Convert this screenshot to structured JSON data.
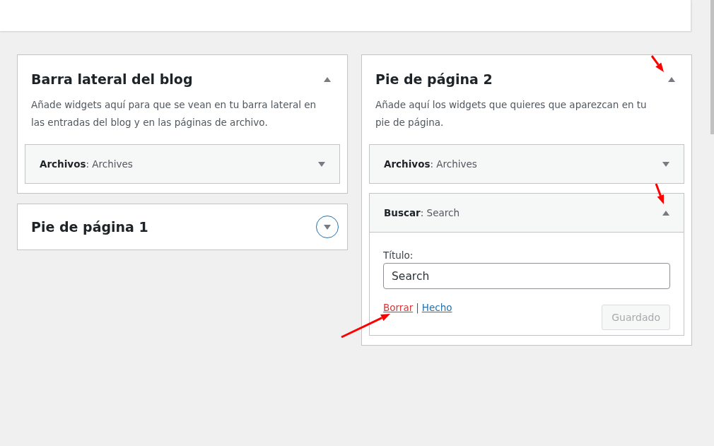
{
  "sidebars_left": [
    {
      "title": "Barra lateral del blog",
      "expanded": true,
      "focused": false,
      "description": "Añade widgets aquí para que se vean en tu barra lateral en las entradas del blog y en las páginas de archivo.",
      "widgets": [
        {
          "title": "**Archivos**: Archives",
          "expanded": false
        }
      ]
    },
    {
      "title": "Pie de página 1",
      "expanded": false,
      "focused": true
    }
  ],
  "sidebars_right": [
    {
      "title": "Pie de página 2",
      "expanded": true,
      "focused": false,
      "description": "Añade aquí los widgets que quieres que aparezcan en tu pie de página.",
      "widgets": [
        {
          "title": "**Archivos**: Archives",
          "expanded": false
        },
        {
          "title": "**Buscar**: Search",
          "expanded": true,
          "form": {
            "label": "Título:",
            "value": "Search",
            "delete_link": "Borrar",
            "separator": "|",
            "done_link": "Hecho",
            "save_button": {
              "label": "Guardado",
              "disabled": true
            }
          }
        }
      ]
    }
  ]
}
